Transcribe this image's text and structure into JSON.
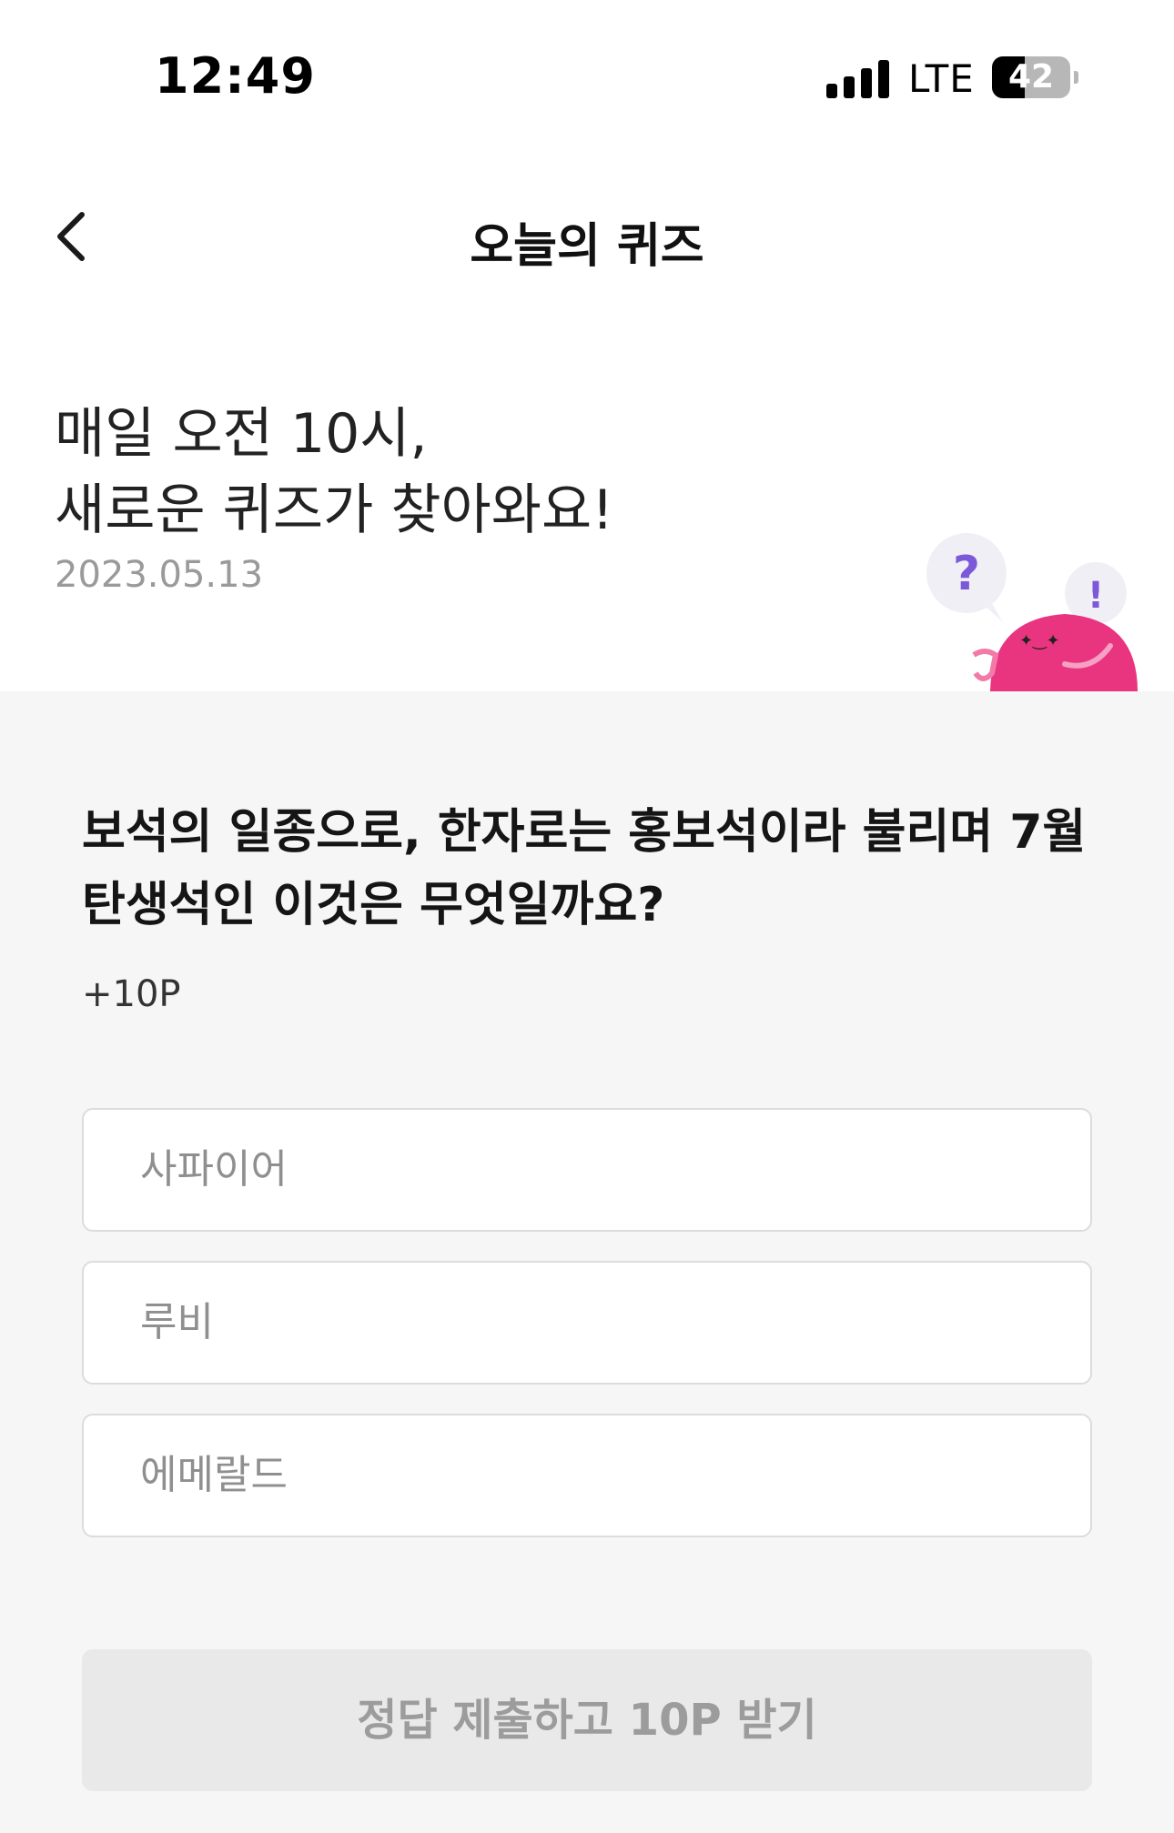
{
  "status_bar": {
    "time": "12:49",
    "network": "LTE",
    "battery_percent": "42",
    "battery_level": 0.42
  },
  "header": {
    "title": "오늘의 퀴즈",
    "back_icon": "chevron-left-icon"
  },
  "intro": {
    "line1": "매일 오전 10시,",
    "line2": "새로운 퀴즈가 찾아와요!",
    "date": "2023.05.13",
    "bubble_question": "?",
    "bubble_exclaim": "!"
  },
  "quiz": {
    "question_line1": "보석의 일종으로, 한자로는 홍보석이라 불리며 7월",
    "question_line2": "탄생석인 이것은 무엇일까요?",
    "points": "+10P",
    "options": [
      {
        "label": "사파이어"
      },
      {
        "label": "루비"
      },
      {
        "label": "에메랄드"
      }
    ],
    "submit_label": "정답 제출하고 10P 받기"
  },
  "colors": {
    "mascot": "#e93580",
    "bubble": "#f0eff6",
    "bubble_mark": "#7b59d8"
  }
}
